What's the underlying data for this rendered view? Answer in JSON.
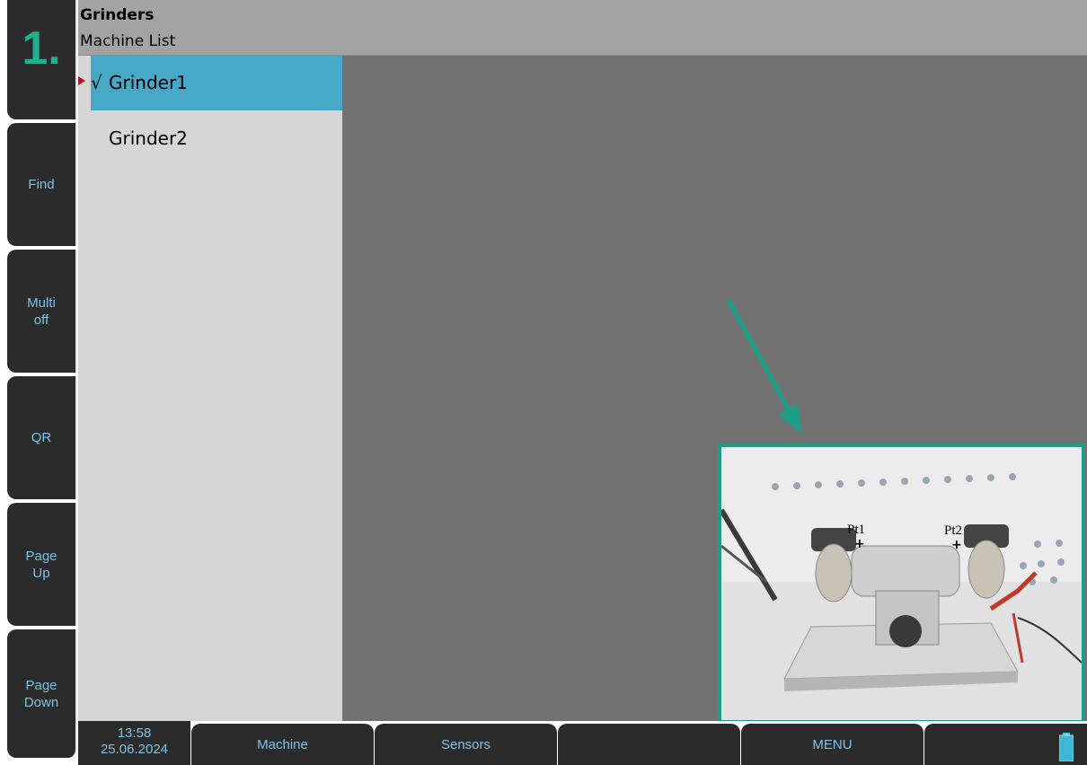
{
  "header": {
    "title": "Grinders",
    "subtitle": "Machine List"
  },
  "left_keys": {
    "index": "1.",
    "find": "Find",
    "multi_line1": "Multi",
    "multi_line2": "off",
    "qr": "QR",
    "pageup_line1": "Page",
    "pageup_line2": "Up",
    "pagedown_line1": "Page",
    "pagedown_line2": "Down"
  },
  "machines": [
    {
      "label": "Grinder1",
      "check": "√",
      "selected": true
    },
    {
      "label": "Grinder2",
      "check": "",
      "selected": false
    }
  ],
  "photo": {
    "pt1": "Pt1",
    "pt2": "Pt2"
  },
  "status": {
    "time": "13:58",
    "date": "25.06.2024"
  },
  "bottom_keys": {
    "machine": "Machine",
    "sensors": "Sensors",
    "empty": "",
    "menu": "MENU"
  },
  "colors": {
    "accent": "#1db28e",
    "selection": "#47a9c8",
    "softkey_text": "#7fc2e8",
    "arrow": "#1a9e86"
  }
}
